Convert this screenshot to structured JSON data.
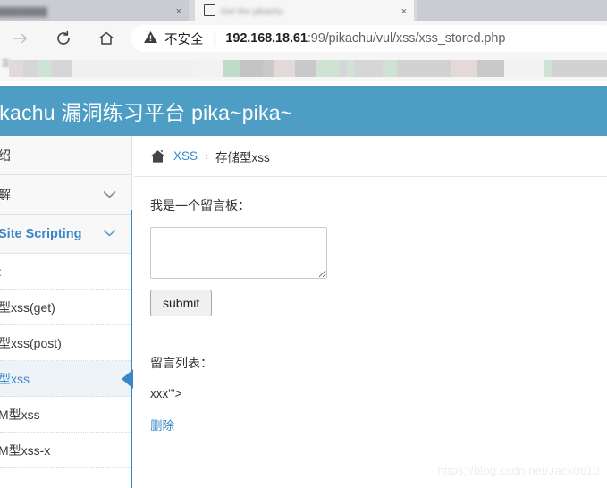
{
  "browser": {
    "tabs": [
      {
        "title": "████████",
        "close_label": "×",
        "active": false
      },
      {
        "title": "Get the pikachu",
        "close_label": "×",
        "active": true
      },
      {
        "title": "",
        "close_label": "",
        "active": false
      }
    ],
    "toolbar": {
      "forward_icon": "arrow-right-icon",
      "reload_icon": "reload-icon",
      "home_icon": "home-icon"
    },
    "omnibox": {
      "warning_icon": "warning-triangle-icon",
      "security_label": "不安全",
      "separator": "|",
      "url_host": "192.168.18.61",
      "url_rest": ":99/pikachu/vul/xss/xss_stored.php"
    },
    "bookmarks_bar": {
      "overflow_glyph": "☰",
      "censored": true
    }
  },
  "site": {
    "banner_title": "ikachu 漏洞练习平台 pika~pika~",
    "banner_color": "#4d9dc4",
    "accent_color": "#3a87c8"
  },
  "sidebar": {
    "items": [
      {
        "label": "绍",
        "type": "group",
        "chevron": false
      },
      {
        "label": "解",
        "type": "group",
        "chevron": true
      },
      {
        "label": "Site Scripting",
        "type": "group-accent",
        "chevron": true
      },
      {
        "label": ":",
        "type": "sub",
        "active": false
      },
      {
        "label": "型xss(get)",
        "type": "sub",
        "active": false
      },
      {
        "label": "型xss(post)",
        "type": "sub",
        "active": false
      },
      {
        "label": "型xss",
        "type": "sub",
        "active": true
      },
      {
        "label": "Μ型xss",
        "type": "sub",
        "active": false
      },
      {
        "label": "Μ型xss-x",
        "type": "sub",
        "active": false
      }
    ]
  },
  "main": {
    "breadcrumb": {
      "home_icon": "home-icon",
      "link": "XSS",
      "separator": "›",
      "current": "存储型xss"
    },
    "form": {
      "label": "我是一个留言板：",
      "textarea_value": "",
      "textarea_placeholder": "",
      "submit_label": "submit"
    },
    "message_list": {
      "title": "留言列表：",
      "entries": [
        {
          "text": "xxx'\">",
          "delete_label": "删除"
        }
      ]
    }
  },
  "watermark": "https://blog.csdn.net/Jack0610"
}
